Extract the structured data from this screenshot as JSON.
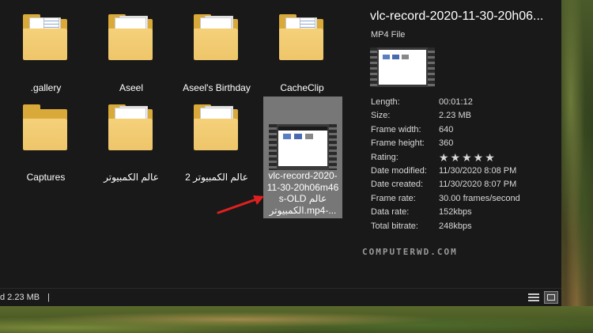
{
  "items": [
    {
      "label": ".gallery"
    },
    {
      "label": "Aseel"
    },
    {
      "label": "Aseel's Birthday"
    },
    {
      "label": "CacheClip"
    },
    {
      "label": "Captures"
    },
    {
      "label": "عالم الكمبيوتر"
    },
    {
      "label": "عالم الكمبيوتر 2"
    },
    {
      "label_lines": [
        "vlc-record-2020-",
        "11-30-20h06m46",
        "s-OLD عالم",
        "الكمبيوتر.mp4-..."
      ]
    }
  ],
  "details": {
    "title": "vlc-record-2020-11-30-20h06...",
    "type": "MP4 File",
    "properties": [
      {
        "key": "Length:",
        "value": "00:01:12"
      },
      {
        "key": "Size:",
        "value": "2.23 MB"
      },
      {
        "key": "Frame width:",
        "value": "640"
      },
      {
        "key": "Frame height:",
        "value": "360"
      },
      {
        "key": "Rating:",
        "value": "★★★★★"
      },
      {
        "key": "Date modified:",
        "value": "11/30/2020 8:08 PM"
      },
      {
        "key": "Date created:",
        "value": "11/30/2020 8:07 PM"
      },
      {
        "key": "Frame rate:",
        "value": "30.00 frames/second"
      },
      {
        "key": "Data rate:",
        "value": "152kbps"
      },
      {
        "key": "Total bitrate:",
        "value": "248kbps"
      }
    ]
  },
  "watermark": "COMPUTERWD.COM",
  "statusbar": {
    "text": "d  2.23 MB",
    "separator": "|"
  },
  "colors": {
    "background": "#191919",
    "selection": "#777777",
    "folder": "#eec56a",
    "arrow": "#e02020"
  },
  "icons": {
    "folder": "folder-icon",
    "video": "video-file-icon",
    "details_view": "details-view-icon",
    "large_icons_view": "large-icons-view-icon"
  }
}
